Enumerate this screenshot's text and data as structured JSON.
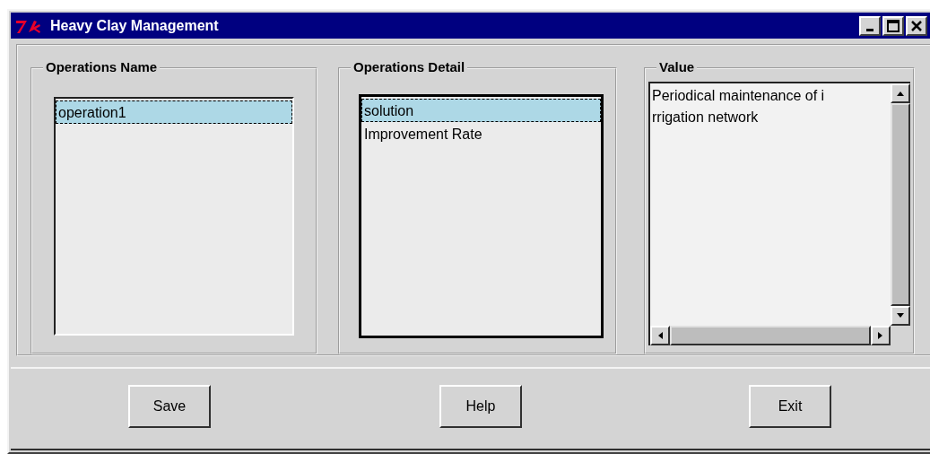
{
  "window": {
    "title": "Heavy Clay Management"
  },
  "groups": [
    {
      "label": "Operations Name",
      "kind": "list",
      "focused": false,
      "items": [
        {
          "text": "operation1",
          "selected": true
        }
      ]
    },
    {
      "label": "Operations Detail",
      "kind": "list",
      "focused": true,
      "items": [
        {
          "text": "solution",
          "selected": true
        },
        {
          "text": "Improvement Rate",
          "selected": false
        }
      ]
    },
    {
      "label": "Value",
      "kind": "text",
      "lines": [
        "Periodical maintenance of i",
        "rrigation network"
      ]
    }
  ],
  "buttons": [
    "Save",
    "Help",
    "Exit"
  ]
}
